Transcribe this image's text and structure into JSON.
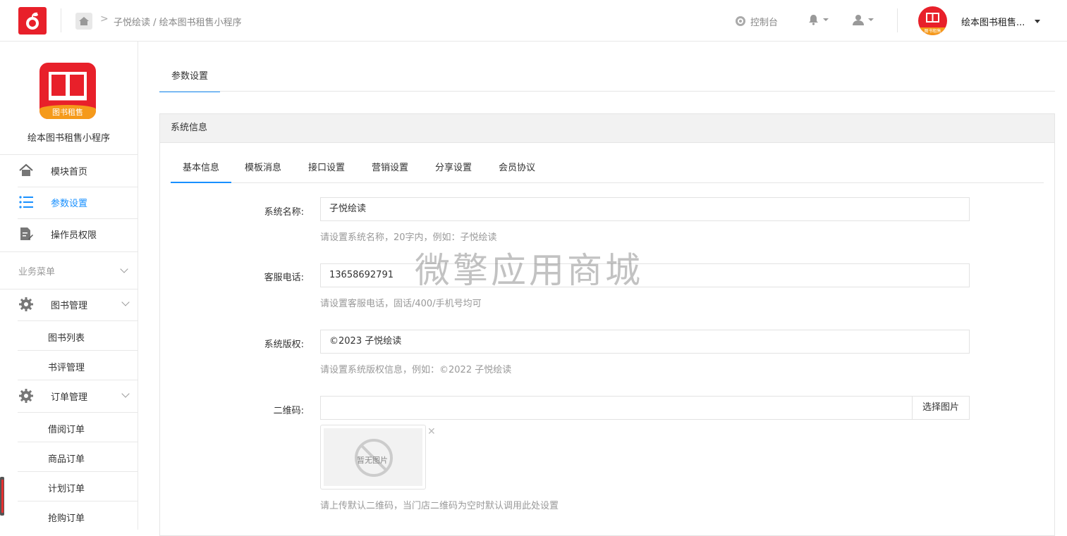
{
  "header": {
    "breadcrumb_arrow": ">",
    "breadcrumb": "子悦绘读 / 绘本图书租售小程序",
    "console_label": "控制台",
    "account_name": "绘本图书租售...",
    "avatar_band_text": "图书租售"
  },
  "sidebar": {
    "logo_band_text": "图书租售",
    "app_name": "绘本图书租售小程序",
    "items": [
      {
        "label": "模块首页",
        "icon": "home-icon"
      },
      {
        "label": "参数设置",
        "icon": "list-icon",
        "active": true
      },
      {
        "label": "操作员权限",
        "icon": "document-edit-icon"
      }
    ],
    "group_title": "业务菜单",
    "book_mgmt": {
      "label": "图书管理",
      "children": [
        "图书列表",
        "书评管理"
      ]
    },
    "order_mgmt": {
      "label": "订单管理",
      "children": [
        "借阅订单",
        "商品订单",
        "计划订单",
        "抢购订单"
      ]
    }
  },
  "main": {
    "page_tab": "参数设置",
    "panel_title": "系统信息",
    "tabs": [
      "基本信息",
      "模板消息",
      "接口设置",
      "营销设置",
      "分享设置",
      "会员协议"
    ],
    "form": {
      "name": {
        "label": "系统名称:",
        "value": "子悦绘读",
        "help": "请设置系统名称，20字内，例如：子悦绘读"
      },
      "phone": {
        "label": "客服电话:",
        "value": "13658692791",
        "help": "请设置客服电话，固话/400/手机号均可"
      },
      "copyright": {
        "label": "系统版权:",
        "value": "©2023 子悦绘读",
        "help": "请设置系统版权信息，例如：©2022 子悦绘读"
      },
      "qrcode": {
        "label": "二维码:",
        "value": "",
        "button": "选择图片",
        "placeholder_img_text": "暂无图片",
        "remove": "✕",
        "help": "请上传默认二维码，当门店二维码为空时默认调用此处设置"
      }
    },
    "watermark": "微擎应用商城"
  },
  "colors": {
    "brand_red": "#e8202a",
    "accent_blue": "#1890ff",
    "band_orange": "#f59a1b"
  }
}
